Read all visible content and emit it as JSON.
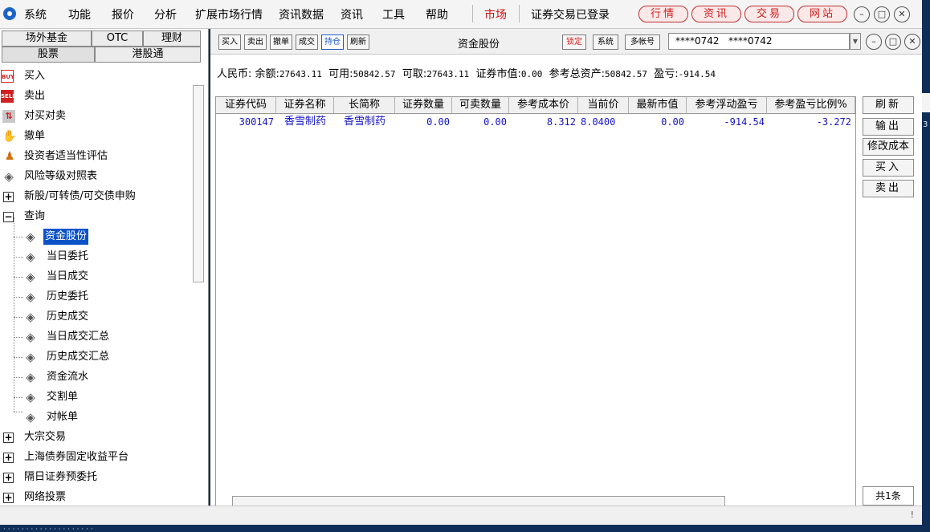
{
  "menubar": {
    "items": [
      "系统",
      "功能",
      "报价",
      "分析",
      "扩展市场行情",
      "资讯数据",
      "资讯",
      "工具",
      "帮助"
    ],
    "market_label": "市场",
    "login_status": "证券交易已登录",
    "pills": [
      "行情",
      "资讯",
      "交易",
      "网站"
    ]
  },
  "left_tabs": {
    "row1": [
      "场外基金",
      "OTC",
      "理财"
    ],
    "row2": [
      "股票",
      "港股通"
    ],
    "active": "股票"
  },
  "tree": {
    "buy": "买入",
    "sell": "卖出",
    "pair_trade": "对买对卖",
    "cancel": "撤单",
    "suitability": "投资者适当性评估",
    "risk_table": "风险等级对照表",
    "ipo": "新股/可转债/可交债申购",
    "query": "查询",
    "query_children": [
      "资金股份",
      "当日委托",
      "当日成交",
      "历史委托",
      "历史成交",
      "当日成交汇总",
      "历史成交汇总",
      "资金流水",
      "交割单",
      "对帐单"
    ],
    "block_trade": "大宗交易",
    "sh_bond": "上海债券固定收益平台",
    "next_day": "隔日证券预委托",
    "online_vote": "网络投票"
  },
  "toolbar": {
    "buttons": [
      "买入",
      "卖出",
      "撤单",
      "成交",
      "持仓",
      "刷新"
    ],
    "active_button": "持仓",
    "title": "资金股份",
    "lock_label": "锁定",
    "system_label": "系统",
    "multi_account_label": "多帐号",
    "account_display": "****0742   ****0742"
  },
  "summary": {
    "currency_label": "人民币:",
    "balance_label": "余额:",
    "balance": "27643.11",
    "available_label": "可用:",
    "available": "50842.57",
    "withdrawable_label": "可取:",
    "withdrawable": "27643.11",
    "market_value_label": "证券市值:",
    "market_value": "0.00",
    "total_assets_label": "参考总资产:",
    "total_assets": "50842.57",
    "pnl_label": "盈亏:",
    "pnl": "-914.54"
  },
  "table": {
    "columns": [
      "证券代码",
      "证券名称",
      "长简称",
      "证券数量",
      "可卖数量",
      "参考成本价",
      "当前价",
      "最新市值",
      "参考浮动盈亏",
      "参考盈亏比例%"
    ],
    "rows": [
      [
        "300147",
        "香雪制药",
        "香雪制药",
        "0.00",
        "0.00",
        "8.312",
        "8.0400",
        "0.00",
        "-914.54",
        "-3.272"
      ]
    ]
  },
  "side_buttons": [
    "刷新",
    "输出",
    "修改成本",
    "买入",
    "卖出"
  ],
  "row_count": "共1条",
  "status_glyph": "!",
  "background_glimpse": "3",
  "colors": {
    "selection": "#0a52c8",
    "data_text": "#1414c8",
    "accent_red": "#d02020"
  }
}
